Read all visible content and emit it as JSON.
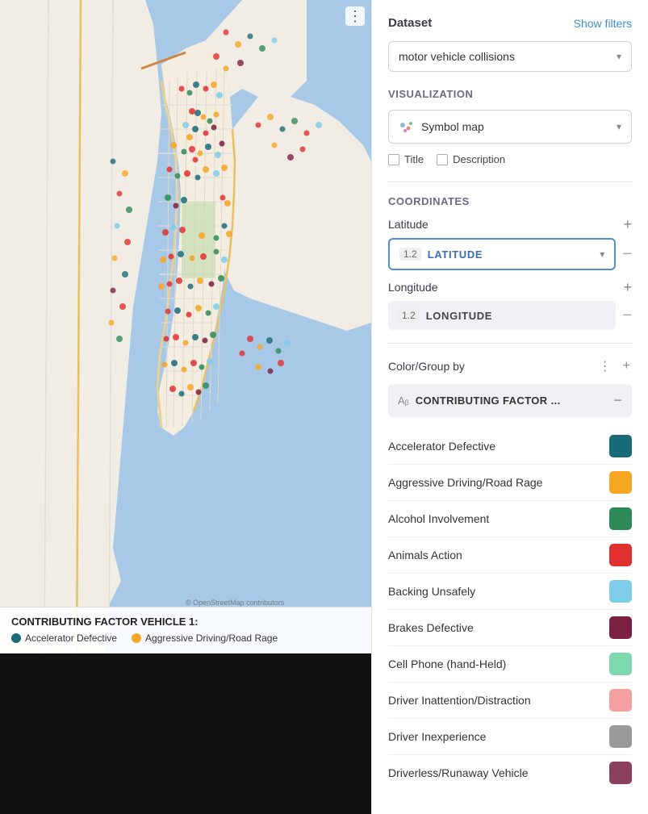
{
  "header": {
    "dataset_label": "Dataset",
    "show_filters": "Show filters",
    "dataset_value": "motor vehicle collisions",
    "more_icon": "⋮"
  },
  "visualization": {
    "section_label": "Visualization",
    "dropdown_value": "Symbol map",
    "title_checkbox": "Title",
    "description_checkbox": "Description"
  },
  "coordinates": {
    "section_label": "Coordinates",
    "latitude_label": "Latitude",
    "longitude_label": "Longitude",
    "latitude_num": "1.2",
    "latitude_text": "LATITUDE",
    "longitude_num": "1.2",
    "longitude_text": "LONGITUDE"
  },
  "color_group": {
    "label": "Color/Group by",
    "contributing_factor_text": "CONTRIBUTING FACTOR ..."
  },
  "legend_items": [
    {
      "label": "Accelerator Defective",
      "color": "#1a6b7a"
    },
    {
      "label": "Aggressive Driving/Road Rage",
      "color": "#f5a623"
    },
    {
      "label": "Alcohol Involvement",
      "color": "#2e8b57"
    },
    {
      "label": "Animals Action",
      "color": "#e03030"
    },
    {
      "label": "Backing Unsafely",
      "color": "#7ecde8"
    },
    {
      "label": "Brakes Defective",
      "color": "#7b2040"
    },
    {
      "label": "Cell Phone (hand-Held)",
      "color": "#7ed8b0"
    },
    {
      "label": "Driver Inattention/Distraction",
      "color": "#f4a0a0"
    },
    {
      "label": "Driver Inexperience",
      "color": "#999999"
    },
    {
      "label": "Driverless/Runaway Vehicle",
      "color": "#8b4060"
    }
  ],
  "map_legend": {
    "title": "CONTRIBUTING FACTOR VEHICLE 1:",
    "items": [
      {
        "label": "Accelerator Defective",
        "color": "#1a6b7a"
      },
      {
        "label": "Aggressive Driving/Road Rage",
        "color": "#f5a623"
      }
    ]
  }
}
